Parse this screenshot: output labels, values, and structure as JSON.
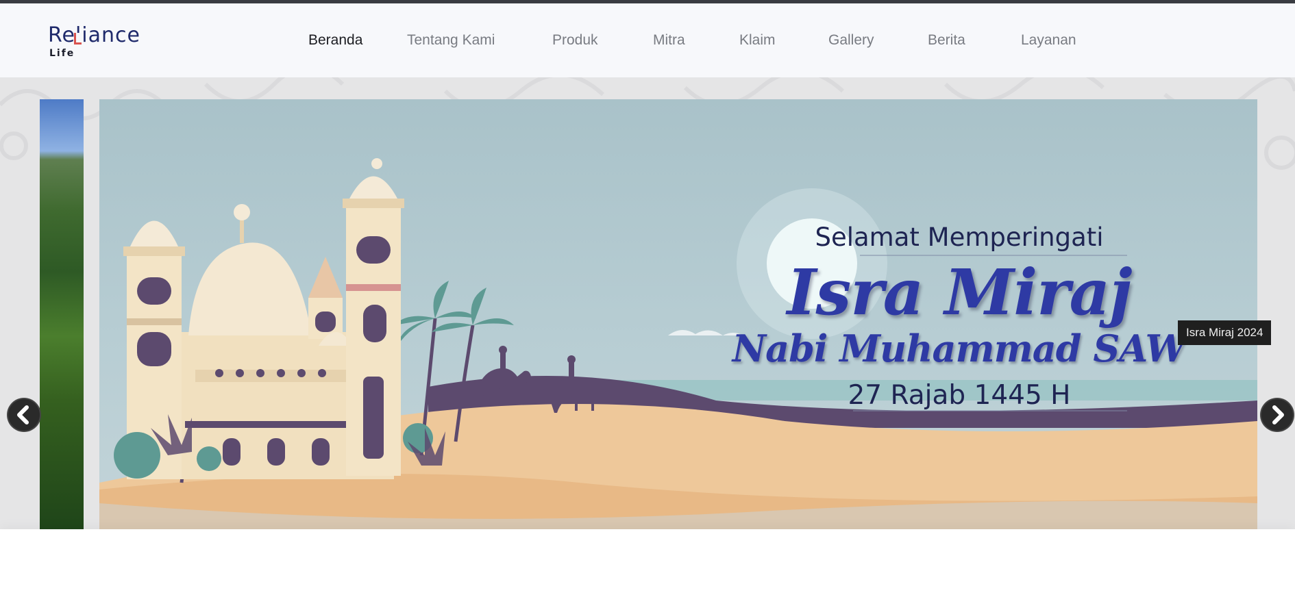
{
  "site": {
    "logo": {
      "word": "Reliance",
      "sub": "Life",
      "brand_color": "#1f2a6b",
      "accent_color": "#d9534f"
    }
  },
  "nav": {
    "items": [
      {
        "label": "Beranda",
        "active": true
      },
      {
        "label": "Tentang Kami",
        "active": false
      },
      {
        "label": "Produk",
        "active": false
      },
      {
        "label": "Mitra",
        "active": false
      },
      {
        "label": "Klaim",
        "active": false
      },
      {
        "label": "Gallery",
        "active": false
      },
      {
        "label": "Berita",
        "active": false
      },
      {
        "label": "Layanan",
        "active": false
      }
    ]
  },
  "slider": {
    "caption": "Isra Miraj 2024",
    "prev_icon": "chevron-left-icon",
    "next_icon": "chevron-right-icon",
    "banner": {
      "greeting": "Selamat Memperingati",
      "headline": "Isra Miraj",
      "subheadline": "Nabi Muhammad SAW",
      "date": "27 Rajab 1445 H",
      "headline_color": "#2e3aa4",
      "text_color": "#1e2452"
    }
  }
}
